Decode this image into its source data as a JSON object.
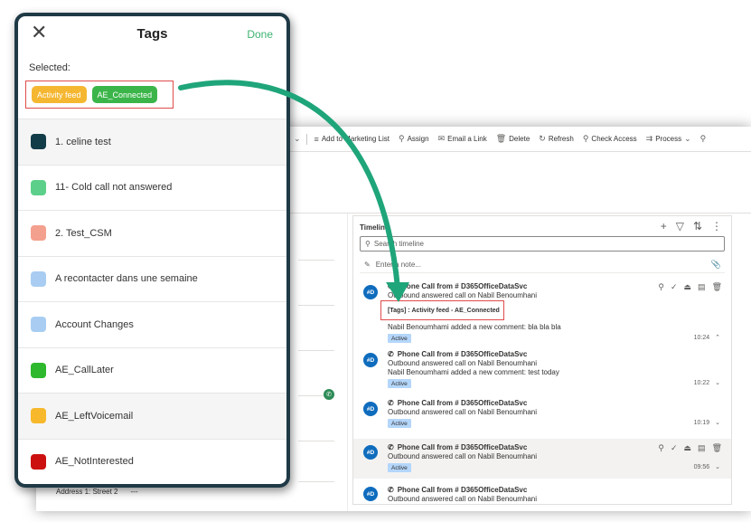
{
  "crm": {
    "commands": [
      {
        "icon": "≡",
        "label": "Add to Marketing List",
        "name": "add-to-marketing-list-button"
      },
      {
        "icon": "⚲",
        "label": "Assign",
        "name": "assign-button"
      },
      {
        "icon": "✉",
        "label": "Email a Link",
        "name": "email-a-link-button"
      },
      {
        "icon": "🗑",
        "label": "Delete",
        "name": "delete-button"
      },
      {
        "icon": "↻",
        "label": "Refresh",
        "name": "refresh-button"
      },
      {
        "icon": "⚲",
        "label": "Check Access",
        "name": "check-access-button"
      },
      {
        "icon": "⇉",
        "label": "Process",
        "name": "process-button"
      }
    ],
    "address_label": "Address 1: Street 2",
    "address_value": "---",
    "timeline": {
      "title": "Timeline",
      "search_placeholder": "Search timeline",
      "note_placeholder": "Enter a note...",
      "records": [
        {
          "avatar": "#D",
          "title": "Phone Call from # D365OfficeDataSvc",
          "line1": "Outbound answered call on Nabil Benoumhani",
          "tag_text": "[Tags] : Activity feed - AE_Connected",
          "line2": "Nabil Benoumhami added a new comment: bla bla bla",
          "status": "Active",
          "time": "10:24"
        },
        {
          "avatar": "#D",
          "title": "Phone Call from # D365OfficeDataSvc",
          "line1": "Outbound answered call on Nabil Benoumhani",
          "line2": "Nabil Benoumhami added a new comment: test today",
          "status": "Active",
          "time": "10:22"
        },
        {
          "avatar": "#D",
          "title": "Phone Call from # D365OfficeDataSvc",
          "line1": "Outbound answered call on Nabil Benoumhani",
          "status": "Active",
          "time": "10:19"
        },
        {
          "avatar": "#D",
          "title": "Phone Call from # D365OfficeDataSvc",
          "line1": "Outbound answered call on Nabil Benoumhani",
          "status": "Active",
          "time": "09:56"
        },
        {
          "avatar": "#D",
          "title": "Phone Call from # D365OfficeDataSvc",
          "line1": "Outbound answered call on Nabil Benoumhani"
        }
      ]
    }
  },
  "tags_panel": {
    "title": "Tags",
    "done_label": "Done",
    "selected_label": "Selected:",
    "selected": [
      {
        "label": "Activity feed",
        "color": "#f5b731"
      },
      {
        "label": "AE_Connected",
        "color": "#3bb54a"
      }
    ],
    "tags": [
      {
        "label": "1. celine test",
        "color": "#123c47"
      },
      {
        "label": "11- Cold call not answered",
        "color": "#5cd08a"
      },
      {
        "label": "2. Test_CSM",
        "color": "#f4a08f"
      },
      {
        "label": "A recontacter dans une semaine",
        "color": "#a9cdf2"
      },
      {
        "label": "Account Changes",
        "color": "#a9cdf2"
      },
      {
        "label": "AE_CallLater",
        "color": "#2db82d"
      },
      {
        "label": "AE_LeftVoicemail",
        "color": "#f7b82b"
      },
      {
        "label": "AE_NotInterested",
        "color": "#cc1010"
      }
    ]
  },
  "colors": {
    "arrow": "#1fa57a",
    "highlight_border": "#e04b4b",
    "done": "#3cb371"
  }
}
